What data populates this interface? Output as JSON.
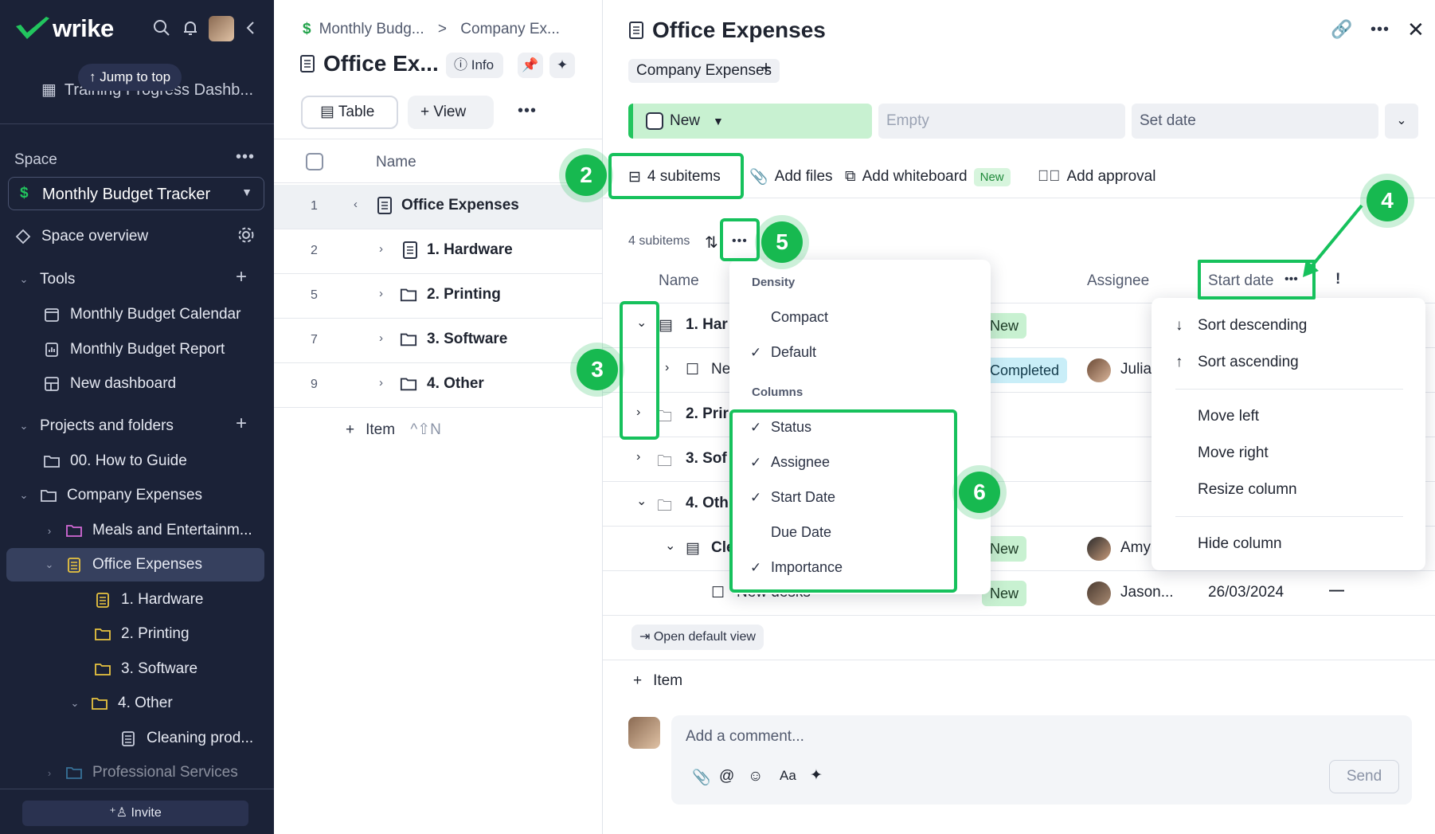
{
  "colors": {
    "sidebar_bg": "#1b2237",
    "accent_green": "#16c15c",
    "status_new": "#c8f1d1",
    "status_completed": "#c9eef8"
  },
  "sidebar": {
    "logo_text": "wrike",
    "jump_to_top": "Jump to top",
    "ghost_item": "Training Progress Dashb...",
    "space_label": "Space",
    "space_selected": "Monthly Budget Tracker",
    "space_overview": "Space overview",
    "tools_label": "Tools",
    "tools": [
      "Monthly Budget Calendar",
      "Monthly Budget Report",
      "New dashboard"
    ],
    "projects_label": "Projects and folders",
    "tree": {
      "how_to": "00. How to Guide",
      "company": "Company Expenses",
      "meals": "Meals and Entertainm...",
      "office": "Office Expenses",
      "hardware": "1. Hardware",
      "printing": "2. Printing",
      "software": "3. Software",
      "other": "4. Other",
      "cleaning": "Cleaning prod...",
      "professional": "Professional Services"
    },
    "invite": "Invite"
  },
  "middle": {
    "breadcrumb_1": "Monthly Budg...",
    "breadcrumb_sep": ">",
    "breadcrumb_2": "Company Ex...",
    "title": "Office Ex...",
    "info_label": "Info",
    "table_btn": "Table",
    "view_btn": "View",
    "name_header": "Name",
    "rows": [
      {
        "num": "1",
        "name": "Office Expenses"
      },
      {
        "num": "2",
        "name": "1. Hardware"
      },
      {
        "num": "5",
        "name": "2. Printing"
      },
      {
        "num": "7",
        "name": "3. Software"
      },
      {
        "num": "9",
        "name": "4. Other"
      }
    ],
    "add_item": "Item",
    "shortcut": "^⇧N"
  },
  "panel": {
    "title": "Office Expenses",
    "tag": "Company Expenses",
    "status": "New",
    "assignee_placeholder": "Empty",
    "date_placeholder": "Set date",
    "subitems_btn": "4 subitems",
    "add_files": "Add files",
    "add_whiteboard": "Add whiteboard",
    "new_badge": "New",
    "add_approval": "Add approval",
    "subitems_count": "4 subitems",
    "col_name": "Name",
    "col_assignee": "Assignee",
    "col_start": "Start date",
    "col_importance": "!",
    "rows": {
      "r1_name": "1. Har",
      "r1_status": "New",
      "r2_name": "Ne",
      "r2_status": "Completed",
      "r2_assignee": "Julia",
      "r3_name": "2. Prir",
      "r4_name": "3. Sof",
      "r5_name": "4. Oth",
      "r6_name": "Cle",
      "r6_status": "New",
      "r6_assignee": "Amy",
      "r7_name": "New desks",
      "r7_status": "New",
      "r7_assignee": "Jason...",
      "r7_date": "26/03/2024",
      "r7_importance": "—"
    },
    "open_default_view": "Open default view",
    "add_item": "Item",
    "comment_placeholder": "Add a comment...",
    "send": "Send",
    "format_label": "Aa"
  },
  "density_menu": {
    "density_label": "Density",
    "compact": "Compact",
    "default": "Default",
    "columns_label": "Columns",
    "columns": [
      {
        "label": "Status",
        "checked": true
      },
      {
        "label": "Assignee",
        "checked": true
      },
      {
        "label": "Start Date",
        "checked": true
      },
      {
        "label": "Due Date",
        "checked": false
      },
      {
        "label": "Importance",
        "checked": true
      }
    ]
  },
  "column_menu": {
    "sort_desc": "Sort descending",
    "sort_asc": "Sort ascending",
    "move_left": "Move left",
    "move_right": "Move right",
    "resize": "Resize column",
    "hide": "Hide column"
  },
  "markers": [
    "2",
    "3",
    "4",
    "5",
    "6"
  ]
}
